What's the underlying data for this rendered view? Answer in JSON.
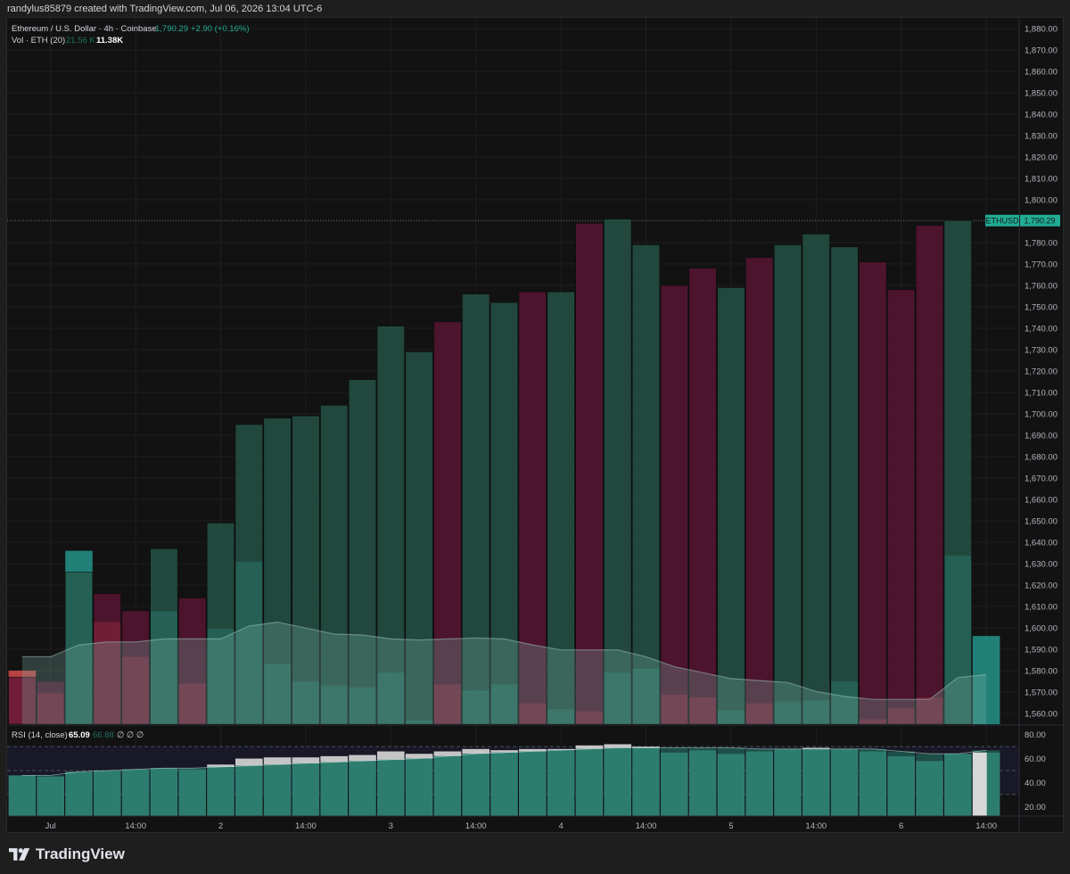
{
  "header": {
    "caption": "randylus85879 created with TradingView.com, Jul 06, 2026 13:04 UTC-6"
  },
  "legend": {
    "symbol_line": "Ethereum / U.S. Dollar · 4h · Coinbase",
    "price": "1,790.29",
    "change": "+2.90 (+0.16%)",
    "vol_label": "Vol · ETH (20)",
    "vol_ma": "21.56 K",
    "vol_value": "11.38K"
  },
  "rsi_legend": {
    "label": "RSI (14, close)",
    "value": "65.09",
    "ma": "66.88",
    "extra": "∅  ∅  ∅"
  },
  "price_tag": {
    "symbol": "ETHUSD",
    "value": "1,790.29"
  },
  "footer": {
    "brand": "TradingView"
  },
  "colors": {
    "up": "#26574a",
    "down": "#5c1535",
    "vol_up": "#26a69a",
    "vol_down": "#ef5350",
    "rsi": "#2d7d6f",
    "accent": "#22ab94"
  },
  "chart_data": {
    "type": "bar",
    "title": "Ethereum / U.S. Dollar · 4h · Coinbase",
    "price_axis": {
      "ylim": [
        1555,
        1885
      ],
      "ticks": [
        "1,560.00",
        "1,570.00",
        "1,580.00",
        "1,590.00",
        "1,600.00",
        "1,610.00",
        "1,620.00",
        "1,630.00",
        "1,640.00",
        "1,650.00",
        "1,660.00",
        "1,670.00",
        "1,680.00",
        "1,690.00",
        "1,700.00",
        "1,710.00",
        "1,720.00",
        "1,730.00",
        "1,740.00",
        "1,750.00",
        "1,760.00",
        "1,770.00",
        "1,780.00",
        "1,790.00",
        "1,800.00",
        "1,810.00",
        "1,820.00",
        "1,830.00",
        "1,840.00",
        "1,850.00",
        "1,860.00",
        "1,870.00",
        "1,880.00"
      ],
      "tick_values": [
        1560,
        1570,
        1580,
        1590,
        1600,
        1610,
        1620,
        1630,
        1640,
        1650,
        1660,
        1670,
        1680,
        1690,
        1700,
        1710,
        1720,
        1730,
        1740,
        1750,
        1760,
        1770,
        1780,
        1790,
        1800,
        1810,
        1820,
        1830,
        1840,
        1850,
        1860,
        1870,
        1880
      ]
    },
    "time_axis": {
      "labels": [
        "Jul",
        "14:00",
        "2",
        "14:00",
        "3",
        "14:00",
        "4",
        "14:00",
        "5",
        "14:00",
        "6",
        "14:00"
      ],
      "label_index": [
        1,
        4,
        7,
        10,
        13,
        16,
        19,
        22,
        25,
        28,
        31,
        34
      ]
    },
    "series": [
      {
        "name": "ETHUSD",
        "direction": [
          "down",
          "down",
          "up",
          "down",
          "down",
          "up",
          "down",
          "up",
          "up",
          "up",
          "up",
          "up",
          "up",
          "up",
          "up",
          "down",
          "up",
          "up",
          "down",
          "up",
          "down",
          "up",
          "up",
          "down",
          "down",
          "up",
          "down",
          "up",
          "up",
          "up",
          "down",
          "down",
          "down",
          "up",
          "up"
        ],
        "values": [
          1577,
          1575,
          1626,
          1616,
          1608,
          1637,
          1614,
          1649,
          1695,
          1698,
          1699,
          1704,
          1716,
          1741,
          1729,
          1743,
          1756,
          1752,
          1757,
          1757,
          1789,
          1791,
          1779,
          1760,
          1768,
          1759,
          1773,
          1779,
          1784,
          1778,
          1771,
          1758,
          1788,
          1790.29
        ]
      },
      {
        "name": "Vol · ETH (20)",
        "direction": [
          "down",
          "down",
          "up",
          "down",
          "down",
          "up",
          "down",
          "up",
          "up",
          "up",
          "up",
          "up",
          "up",
          "up",
          "up",
          "down",
          "up",
          "up",
          "down",
          "up",
          "down",
          "up",
          "up",
          "down",
          "down",
          "up",
          "down",
          "up",
          "up",
          "up",
          "down",
          "down",
          "down",
          "up",
          "up"
        ],
        "values": [
          5.4,
          3.1,
          17.5,
          10.3,
          6.8,
          11.4,
          4.1,
          9.6,
          16.4,
          6.1,
          4.3,
          3.9,
          3.7,
          5.2,
          0.4,
          4.0,
          3.4,
          4.0,
          2.1,
          1.5,
          1.3,
          5.2,
          5.6,
          3.0,
          2.7,
          1.4,
          2.1,
          2.3,
          2.4,
          4.3,
          0.5,
          1.6,
          2.7,
          17.0,
          8.9
        ],
        "ma_values": [
          6.8,
          6.8,
          8.0,
          8.3,
          8.3,
          8.6,
          8.6,
          8.6,
          9.9,
          10.3,
          9.7,
          9.1,
          9.0,
          8.6,
          8.5,
          8.6,
          8.7,
          8.6,
          8.0,
          7.5,
          7.5,
          7.5,
          6.8,
          5.8,
          5.2,
          4.6,
          4.4,
          4.2,
          3.3,
          2.8,
          2.5,
          2.5,
          2.5,
          4.7,
          5.0
        ]
      },
      {
        "name": "RSI (14, close)",
        "values": [
          46,
          45,
          49,
          50,
          51,
          52,
          51,
          55,
          60,
          61,
          61,
          62,
          63,
          66,
          64,
          66,
          68,
          67,
          68,
          68,
          71,
          72,
          70,
          65,
          67,
          64,
          66,
          68,
          69,
          68,
          66,
          62,
          58,
          64,
          65.09
        ],
        "ma_values": [
          46,
          46,
          49,
          50,
          51,
          52,
          52,
          53,
          54,
          55,
          56,
          57,
          58,
          59,
          60,
          62,
          64,
          65,
          66,
          67,
          68,
          69,
          69,
          69,
          69,
          69,
          68,
          68,
          68,
          68,
          68,
          66,
          64,
          64,
          66.88
        ],
        "ylim": [
          12,
          88
        ],
        "ticks": [
          "80.00",
          "60.00",
          "40.00",
          "20.00"
        ],
        "tick_values": [
          80,
          60,
          40,
          20
        ],
        "bands": [
          70,
          50,
          30
        ]
      }
    ],
    "current_price": 1790.29,
    "grid": true
  }
}
